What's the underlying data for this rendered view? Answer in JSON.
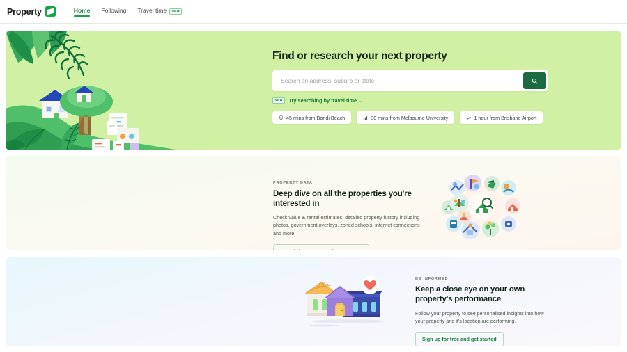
{
  "header": {
    "logo_text": "Property",
    "nav": [
      {
        "label": "Home",
        "active": true,
        "badge": ""
      },
      {
        "label": "Following",
        "active": false,
        "badge": ""
      },
      {
        "label": "Travel time",
        "active": false,
        "badge": "NEW"
      }
    ]
  },
  "hero": {
    "title": "Find or research your next property",
    "search_placeholder": "Search an address, suburb or state",
    "search_value": "",
    "travel_link": "Try searching by travel time →",
    "travel_badge": "NEW",
    "chips": [
      {
        "label": "45 mins from Bondi Beach",
        "icon": "train-icon"
      },
      {
        "label": "30 mins from Melbourne University",
        "icon": "tram-icon"
      },
      {
        "label": "1 hour from Brisbane Airport",
        "icon": "plane-icon"
      }
    ]
  },
  "section2": {
    "eyebrow": "PROPERTY DATA",
    "title": "Deep dive on all the properties you're interested in",
    "body": "Check value & rental estimates, detailed property history including photos, government overlays, zoned schools, internet connections and more.",
    "cta": "Search for any Australian property"
  },
  "section3": {
    "eyebrow": "BE INFORMED",
    "title": "Keep a close eye on your own property's performance",
    "body": "Follow your property to see personalised insights into how your property and it's location are performing.",
    "cta": "Sign up for free and get started"
  },
  "colors": {
    "brand_green": "#16a34a",
    "dark_green": "#1a6b42",
    "link_green": "#13803a",
    "hero_bg": "#d0f0a3"
  }
}
